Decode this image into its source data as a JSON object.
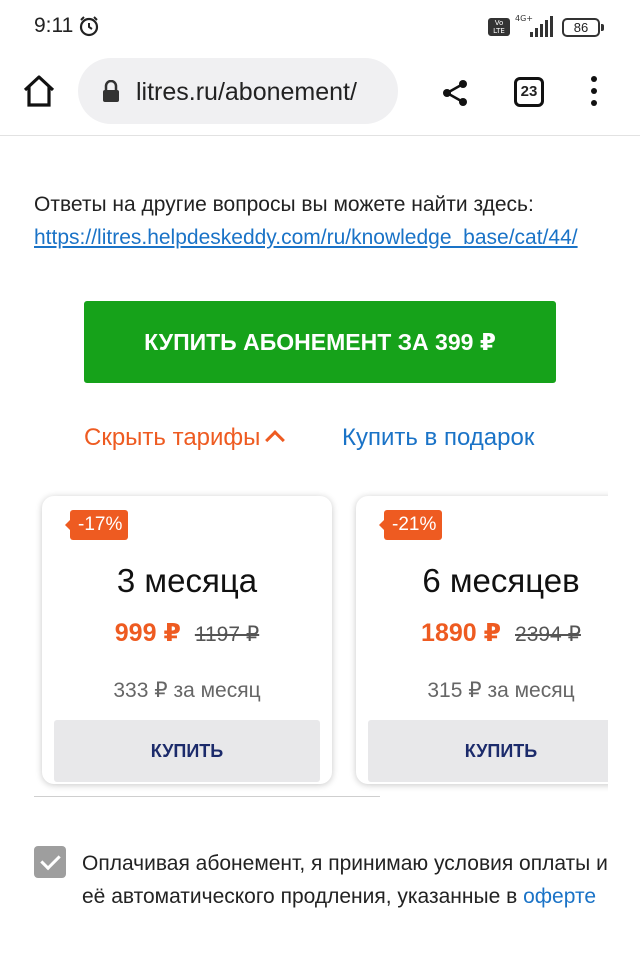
{
  "status_bar": {
    "time": "9:11",
    "volte": "Vo LTE",
    "network": "4G+",
    "battery": "86"
  },
  "browser": {
    "url": "litres.ru/abonement/",
    "tab_count": "23"
  },
  "content": {
    "help_text": "Ответы на другие вопросы вы можете найти здесь:",
    "help_link": "https://litres.helpdeskeddy.com/ru/knowledge_base/cat/44/",
    "buy_button": "КУПИТЬ АБОНЕМЕНТ ЗА 399 ₽",
    "hide_tariffs": "Скрыть тарифы",
    "gift_link": "Купить в подарок"
  },
  "tariffs": [
    {
      "discount": "-17%",
      "title": "3 месяца",
      "price": "999 ₽",
      "old_price": "1197 ₽",
      "monthly": "333 ₽ за месяц",
      "buy_label": "КУПИТЬ"
    },
    {
      "discount": "-21%",
      "title": "6 месяцев",
      "price": "1890 ₽",
      "old_price": "2394 ₽",
      "monthly": "315 ₽ за месяц",
      "buy_label": "КУПИТЬ"
    }
  ],
  "consent": {
    "checked": true,
    "text": "Оплачивая абонемент, я принимаю условия оплаты и её автоматического продления, указанные в",
    "link": "оферте"
  },
  "colors": {
    "accent_green": "#16a21a",
    "accent_orange": "#ee5b21",
    "link_blue": "#1a73c7",
    "button_text_navy": "#1c2b6b"
  }
}
